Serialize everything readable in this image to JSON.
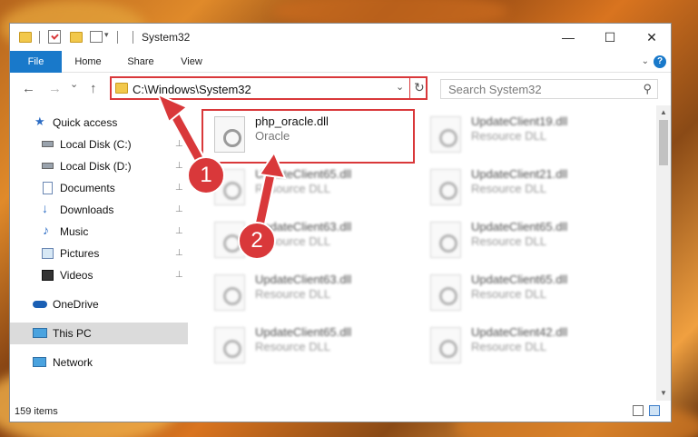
{
  "window": {
    "title": "System32",
    "controls": {
      "minimize": "—",
      "maximize": "☐",
      "close": "✕"
    }
  },
  "ribbon": {
    "tabs": [
      "File",
      "Home",
      "Share",
      "View"
    ],
    "help": "?"
  },
  "nav": {
    "back": "←",
    "forward": "→",
    "recent": "⌄",
    "up": "↑",
    "address": "C:\\Windows\\System32",
    "refresh": "↻",
    "search_placeholder": "Search System32",
    "search_icon_glyph": "⚲"
  },
  "sidebar": {
    "items": [
      {
        "label": "Quick access",
        "icon": "star-icon",
        "pinned": false
      },
      {
        "label": "Local Disk (C:)",
        "icon": "disk-icon",
        "pinned": true
      },
      {
        "label": "Local Disk (D:)",
        "icon": "disk-icon",
        "pinned": true
      },
      {
        "label": "Documents",
        "icon": "documents-icon",
        "pinned": true
      },
      {
        "label": "Downloads",
        "icon": "downloads-icon",
        "pinned": true
      },
      {
        "label": "Music",
        "icon": "music-icon",
        "pinned": true
      },
      {
        "label": "Pictures",
        "icon": "pictures-icon",
        "pinned": true
      },
      {
        "label": "Videos",
        "icon": "videos-icon",
        "pinned": true
      },
      {
        "label": "OneDrive",
        "icon": "onedrive-icon",
        "pinned": false
      },
      {
        "label": "This PC",
        "icon": "this-pc-icon",
        "pinned": false,
        "active": true
      },
      {
        "label": "Network",
        "icon": "network-icon",
        "pinned": false
      }
    ],
    "pin_glyph": "📌"
  },
  "files": {
    "highlighted": {
      "name": "php_oracle.dll",
      "description": "Oracle"
    },
    "blurred": [
      {
        "name": "UpdateClient65.dll",
        "description": "Resource DLL"
      },
      {
        "name": "UpdateClient63.dll",
        "description": "Resource DLL"
      },
      {
        "name": "UpdateClient63.dll",
        "description": "Resource DLL"
      },
      {
        "name": "UpdateClient65.dll",
        "description": "Resource DLL"
      },
      {
        "name": "UpdateClient19.dll",
        "description": "Resource DLL"
      },
      {
        "name": "UpdateClient21.dll",
        "description": "Resource DLL"
      },
      {
        "name": "UpdateClient65.dll",
        "description": "Resource DLL"
      },
      {
        "name": "UpdateClient65.dll",
        "description": "Resource DLL"
      },
      {
        "name": "UpdateClient42.dll",
        "description": "Resource DLL"
      }
    ]
  },
  "status": {
    "item_count": "159 items"
  },
  "annotations": {
    "step1": "1",
    "step2": "2"
  },
  "colors": {
    "accent": "#1979ca",
    "highlight": "#d9383a"
  }
}
